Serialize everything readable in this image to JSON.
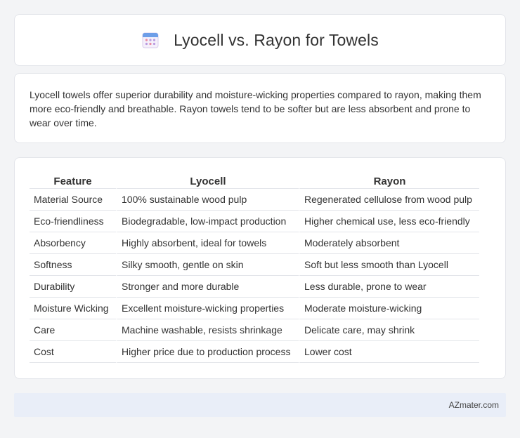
{
  "header": {
    "title": "Lyocell vs. Rayon for Towels",
    "icon": "calendar-icon"
  },
  "summary": {
    "text": "Lyocell towels offer superior durability and moisture-wicking properties compared to rayon, making them more eco-friendly and breathable. Rayon towels tend to be softer but are less absorbent and prone to wear over time."
  },
  "table": {
    "headers": [
      "Feature",
      "Lyocell",
      "Rayon"
    ],
    "rows": [
      [
        "Material Source",
        "100% sustainable wood pulp",
        "Regenerated cellulose from wood pulp"
      ],
      [
        "Eco-friendliness",
        "Biodegradable, low-impact production",
        "Higher chemical use, less eco-friendly"
      ],
      [
        "Absorbency",
        "Highly absorbent, ideal for towels",
        "Moderately absorbent"
      ],
      [
        "Softness",
        "Silky smooth, gentle on skin",
        "Soft but less smooth than Lyocell"
      ],
      [
        "Durability",
        "Stronger and more durable",
        "Less durable, prone to wear"
      ],
      [
        "Moisture Wicking",
        "Excellent moisture-wicking properties",
        "Moderate moisture-wicking"
      ],
      [
        "Care",
        "Machine washable, resists shrinkage",
        "Delicate care, may shrink"
      ],
      [
        "Cost",
        "Higher price due to production process",
        "Lower cost"
      ]
    ]
  },
  "footer": {
    "brand": "AZmater.com"
  },
  "colors": {
    "background": "#f3f4f6",
    "card": "#ffffff",
    "border": "#e3e5ea",
    "footer_bg": "#e9eef8",
    "text": "#333333"
  }
}
